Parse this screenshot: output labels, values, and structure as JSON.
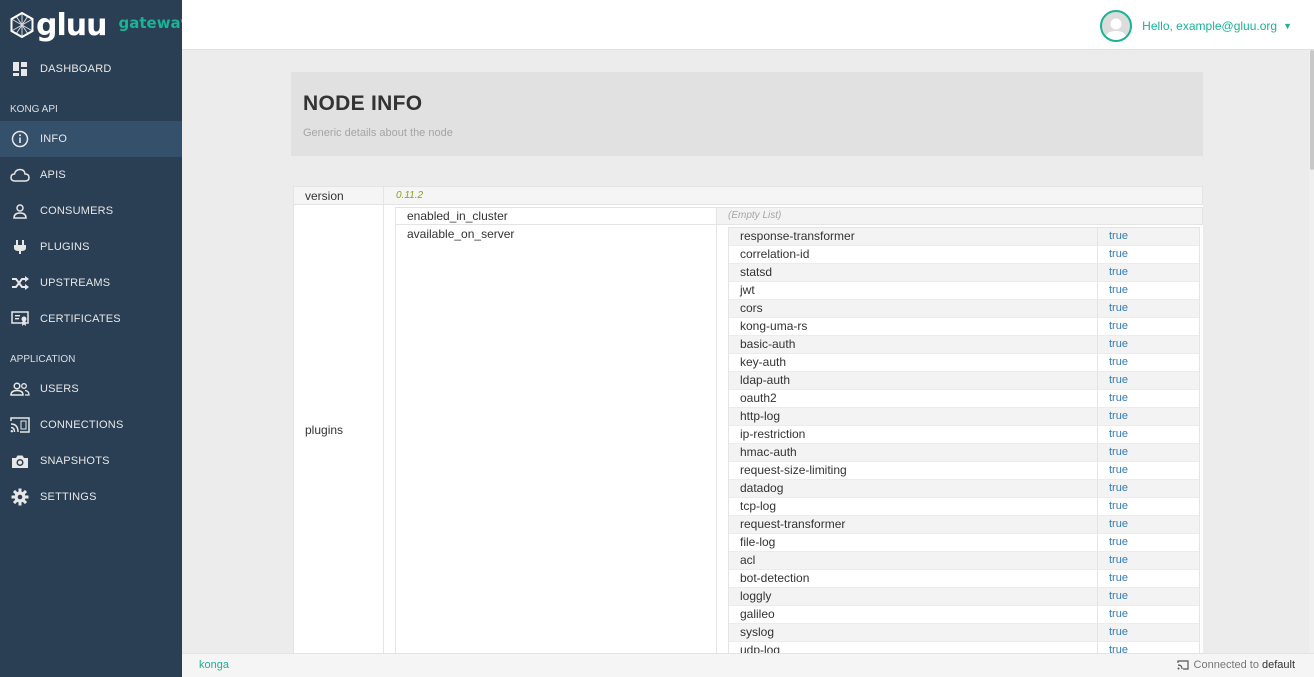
{
  "brand": {
    "name": "gluu",
    "sub": "gateway"
  },
  "nav": {
    "dashboard": "DASHBOARD",
    "kong_section": "KONG API",
    "kong_items": [
      {
        "label": "INFO",
        "icon": "info-icon"
      },
      {
        "label": "APIS",
        "icon": "cloud-icon"
      },
      {
        "label": "CONSUMERS",
        "icon": "user-icon"
      },
      {
        "label": "PLUGINS",
        "icon": "plug-icon"
      },
      {
        "label": "UPSTREAMS",
        "icon": "shuffle-icon"
      },
      {
        "label": "CERTIFICATES",
        "icon": "certificate-icon"
      }
    ],
    "app_section": "APPLICATION",
    "app_items": [
      {
        "label": "USERS",
        "icon": "users-icon"
      },
      {
        "label": "CONNECTIONS",
        "icon": "cast-icon"
      },
      {
        "label": "SNAPSHOTS",
        "icon": "camera-icon"
      },
      {
        "label": "SETTINGS",
        "icon": "gear-icon"
      }
    ]
  },
  "user": {
    "greeting": "Hello, example@gluu.org"
  },
  "page": {
    "title": "NODE INFO",
    "subtitle": "Generic details about the node"
  },
  "info": {
    "version_key": "version",
    "version_value": "0.11.2",
    "plugins_key": "plugins",
    "enabled_key": "enabled_in_cluster",
    "enabled_value": "(Empty List)",
    "available_key": "available_on_server",
    "available": [
      {
        "name": "response-transformer",
        "value": "true"
      },
      {
        "name": "correlation-id",
        "value": "true"
      },
      {
        "name": "statsd",
        "value": "true"
      },
      {
        "name": "jwt",
        "value": "true"
      },
      {
        "name": "cors",
        "value": "true"
      },
      {
        "name": "kong-uma-rs",
        "value": "true"
      },
      {
        "name": "basic-auth",
        "value": "true"
      },
      {
        "name": "key-auth",
        "value": "true"
      },
      {
        "name": "ldap-auth",
        "value": "true"
      },
      {
        "name": "oauth2",
        "value": "true"
      },
      {
        "name": "http-log",
        "value": "true"
      },
      {
        "name": "ip-restriction",
        "value": "true"
      },
      {
        "name": "hmac-auth",
        "value": "true"
      },
      {
        "name": "request-size-limiting",
        "value": "true"
      },
      {
        "name": "datadog",
        "value": "true"
      },
      {
        "name": "tcp-log",
        "value": "true"
      },
      {
        "name": "request-transformer",
        "value": "true"
      },
      {
        "name": "file-log",
        "value": "true"
      },
      {
        "name": "acl",
        "value": "true"
      },
      {
        "name": "bot-detection",
        "value": "true"
      },
      {
        "name": "loggly",
        "value": "true"
      },
      {
        "name": "galileo",
        "value": "true"
      },
      {
        "name": "syslog",
        "value": "true"
      },
      {
        "name": "udp-log",
        "value": "true"
      }
    ]
  },
  "footer": {
    "left": "konga",
    "connected_label": "Connected to",
    "connection": "default"
  }
}
